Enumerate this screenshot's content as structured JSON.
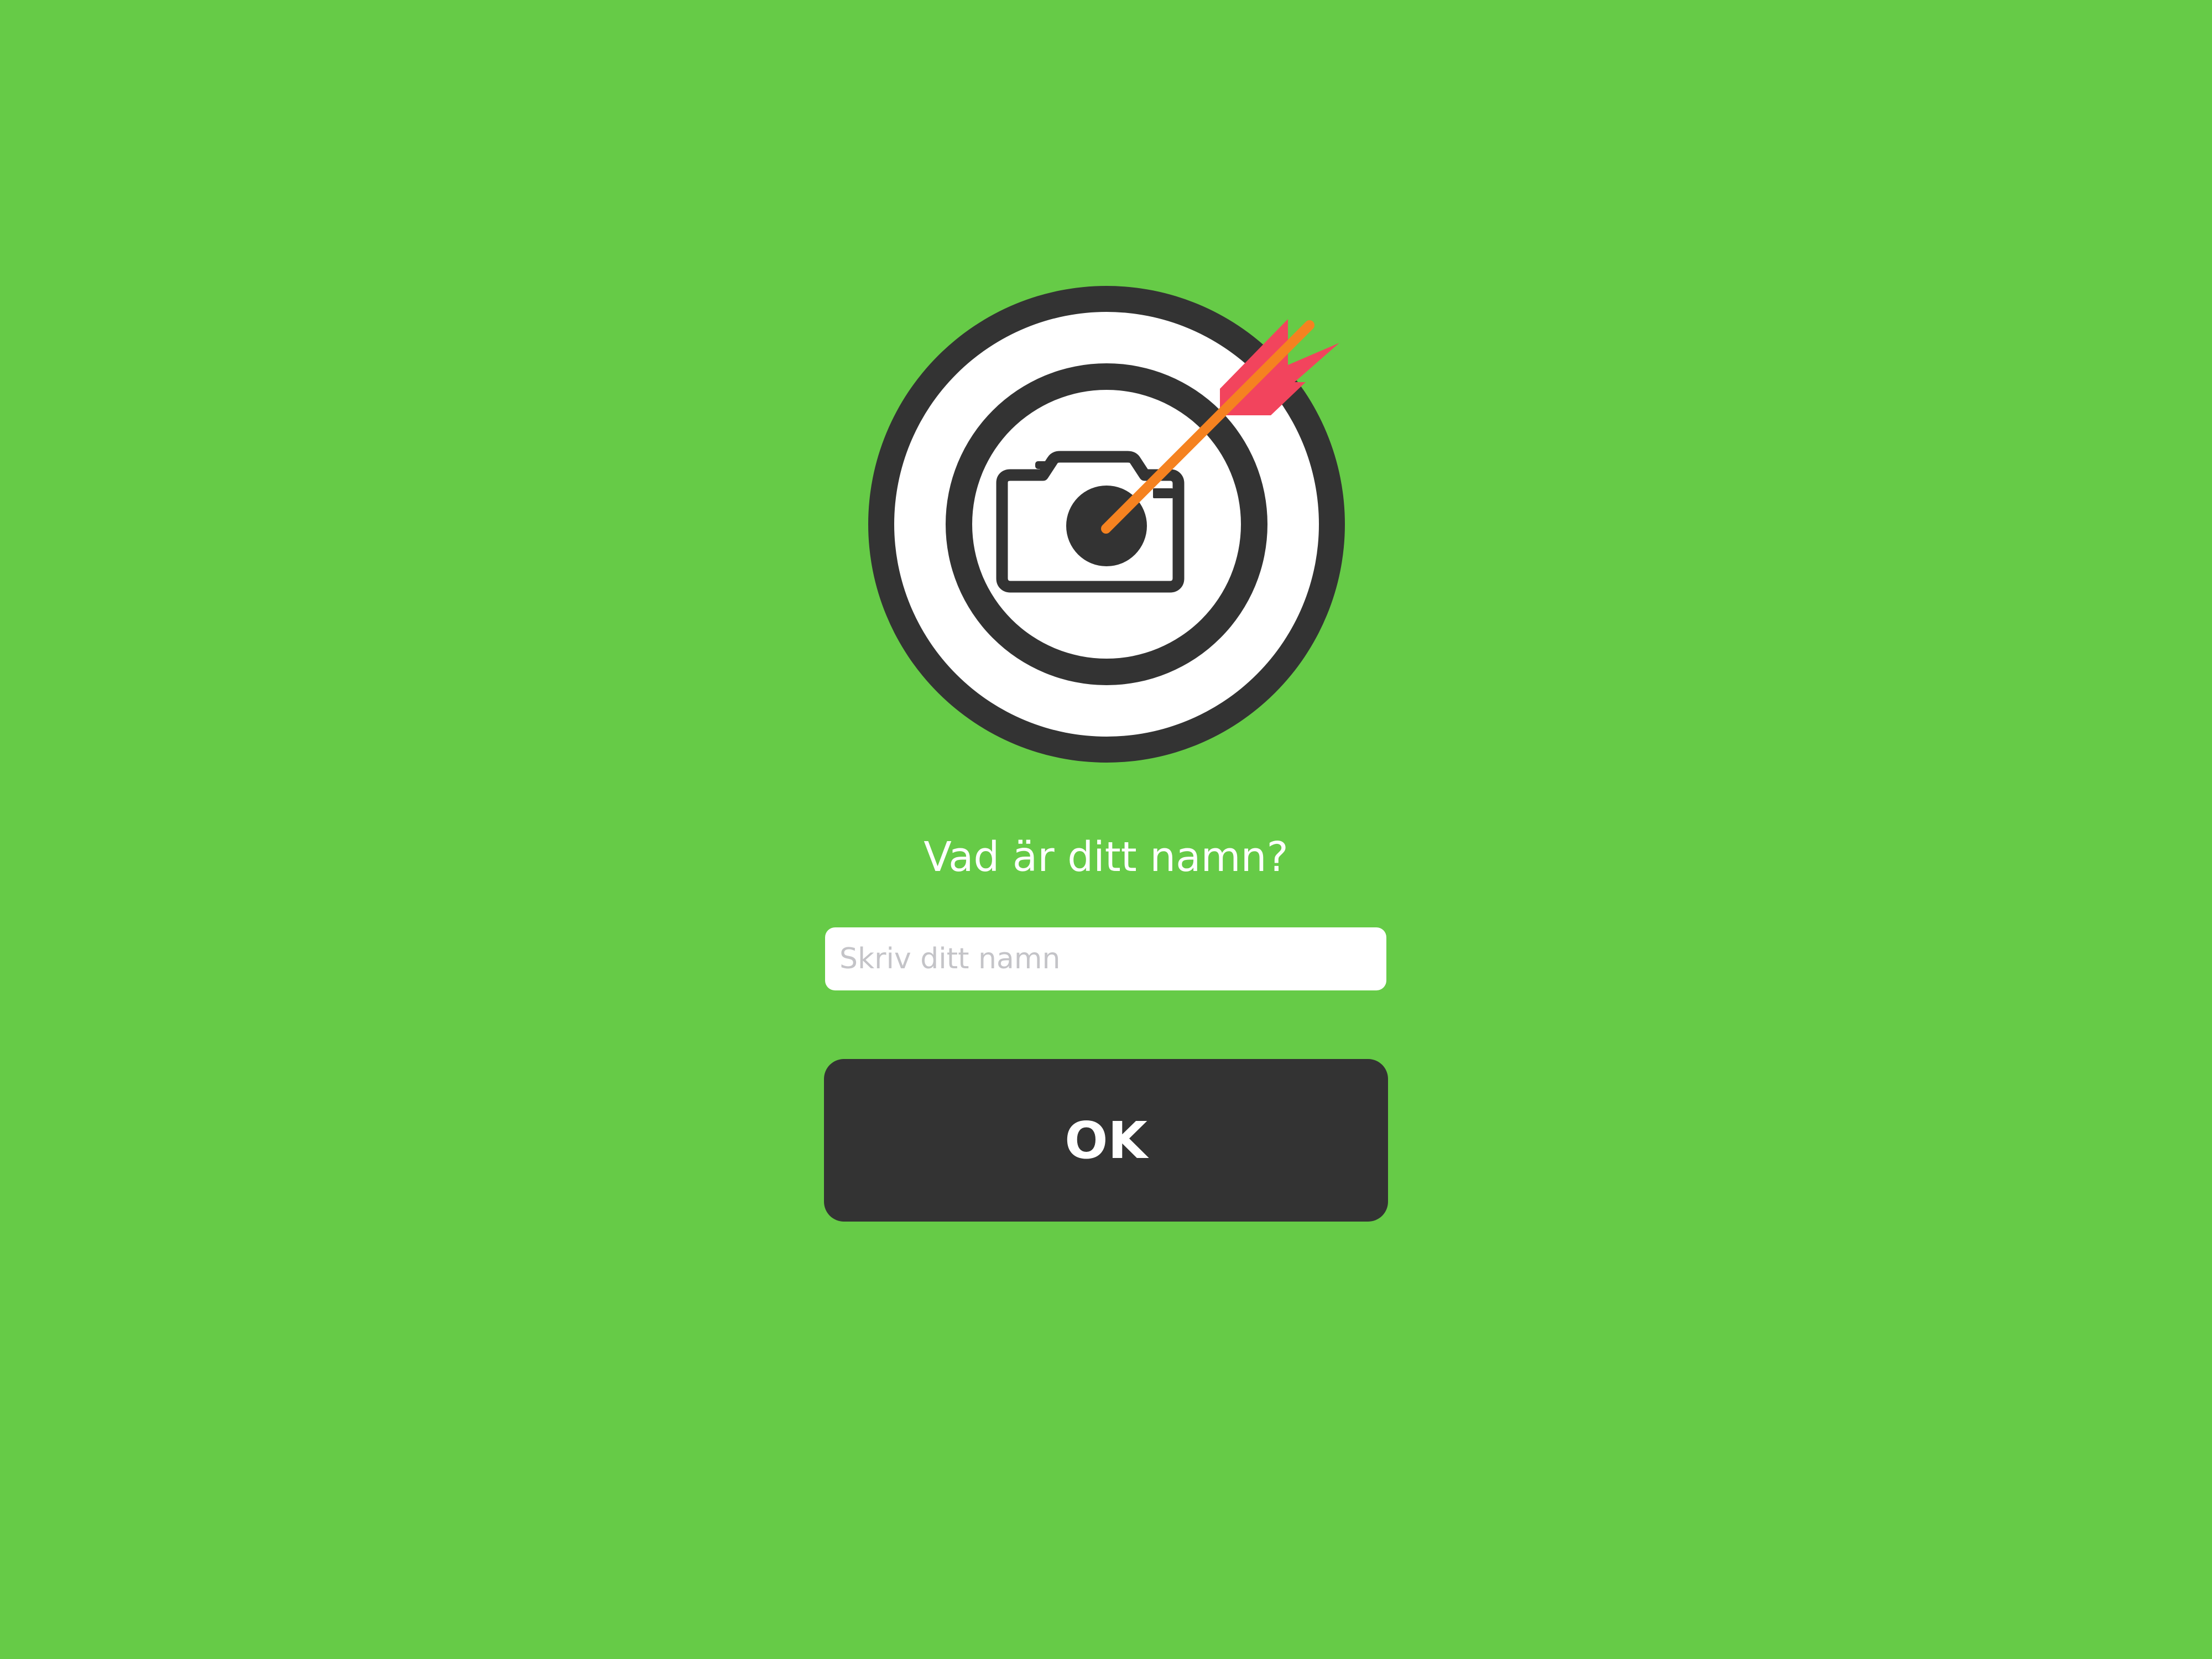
{
  "app": {
    "logo_icon": "target-camera-arrow-icon",
    "prompt": "Vad är ditt namn?",
    "name_input": {
      "value": "",
      "placeholder": "Skriv ditt namn"
    },
    "ok_button": {
      "label": "OK"
    }
  },
  "colors": {
    "background": "#66cb47",
    "dark": "#333333",
    "white": "#ffffff",
    "arrow_fletching": "#f2445d",
    "arrow_shaft": "#f58220",
    "placeholder": "#c4c4c8"
  }
}
